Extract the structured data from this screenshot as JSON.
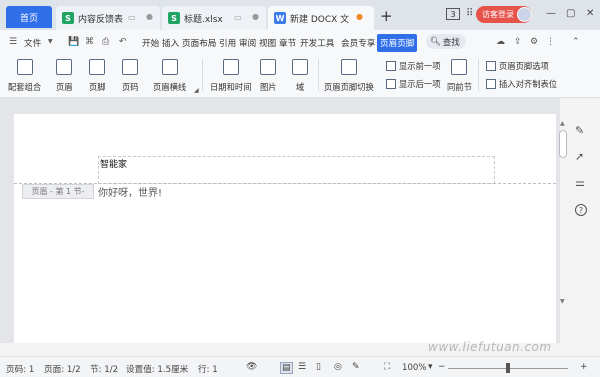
{
  "titlebar": {
    "home_tab": "首页",
    "tabs": [
      {
        "label": "内容反馈表",
        "icon": "S"
      },
      {
        "label": "标题.xlsx",
        "icon": "S"
      },
      {
        "label": "新建 DOCX 文",
        "icon": "W"
      }
    ],
    "doc_count": "3",
    "visitor_login": "访客登录"
  },
  "menu": {
    "file": "文件",
    "items": [
      "开始",
      "插入",
      "页面布局",
      "引用",
      "审阅",
      "视图",
      "章节",
      "开发工具",
      "会员专享",
      "页眉页脚"
    ],
    "active_item": "页眉页脚",
    "search": "查找"
  },
  "ribbon": {
    "big_buttons": [
      "配套组合",
      "页眉",
      "页脚",
      "页码",
      "页眉横线",
      "日期和时间",
      "图片",
      "域",
      "页眉页脚切换",
      "同前节"
    ],
    "small_buttons": [
      "显示前一项",
      "显示后一项",
      "页眉页脚选项",
      "插入对齐制表位"
    ]
  },
  "document": {
    "header_text": "智能家",
    "header_label": "页眉 - 第 1 节-",
    "body_text": "你好呀，世界!"
  },
  "statusbar": {
    "page_number": "页码: 1",
    "pages": "页面: 1/2",
    "section": "节: 1/2",
    "setting": "设置值: 1.5厘米",
    "line": "行: 1",
    "zoom": "100%",
    "zoom_level": 0.5
  },
  "watermark": "www.liefutuan.com",
  "colors": {
    "accent": "#2f6fea",
    "visitor": "#e5534b"
  }
}
